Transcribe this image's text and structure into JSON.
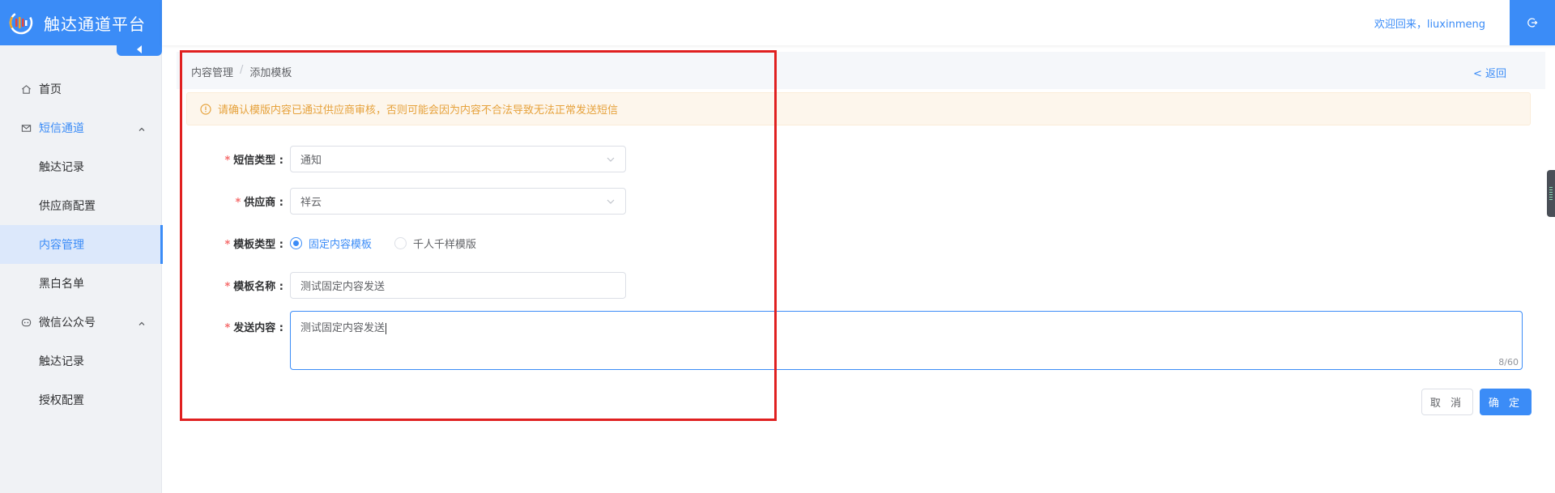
{
  "app": {
    "title": "触达通道平台",
    "brand_color": "#3b8cf7"
  },
  "header": {
    "welcome": "欢迎回来，liuxinmeng",
    "logout_icon": "logout-icon"
  },
  "sidebar": {
    "items": [
      {
        "label": "首页",
        "icon": "home-icon"
      },
      {
        "label": "短信通道",
        "icon": "mail-icon"
      },
      {
        "label": "触达记录"
      },
      {
        "label": "供应商配置"
      },
      {
        "label": "内容管理"
      },
      {
        "label": "黑白名单"
      },
      {
        "label": "微信公众号",
        "icon": "wechat-icon"
      },
      {
        "label": "触达记录"
      },
      {
        "label": "授权配置"
      }
    ]
  },
  "breadcrumb": {
    "items": [
      "内容管理",
      "添加模板"
    ],
    "separator": "/",
    "back": "< 返回"
  },
  "alert": {
    "text": "请确认模版内容已通过供应商审核，否则可能会因为内容不合法导致无法正常发送短信"
  },
  "form": {
    "required_mark": "*",
    "sms_type": {
      "label": "短信类型 :",
      "value": "通知"
    },
    "supplier": {
      "label": "供应商 :",
      "value": "祥云"
    },
    "template_type": {
      "label": "模板类型 :",
      "options": [
        "固定内容模板",
        "千人千样模版"
      ],
      "selected": "固定内容模板"
    },
    "template_name": {
      "label": "模板名称 :",
      "value": "测试固定内容发送"
    },
    "content": {
      "label": "发送内容 :",
      "value": "测试固定内容发送",
      "counter": "8/60"
    }
  },
  "buttons": {
    "cancel": "取 消",
    "confirm": "确 定"
  }
}
